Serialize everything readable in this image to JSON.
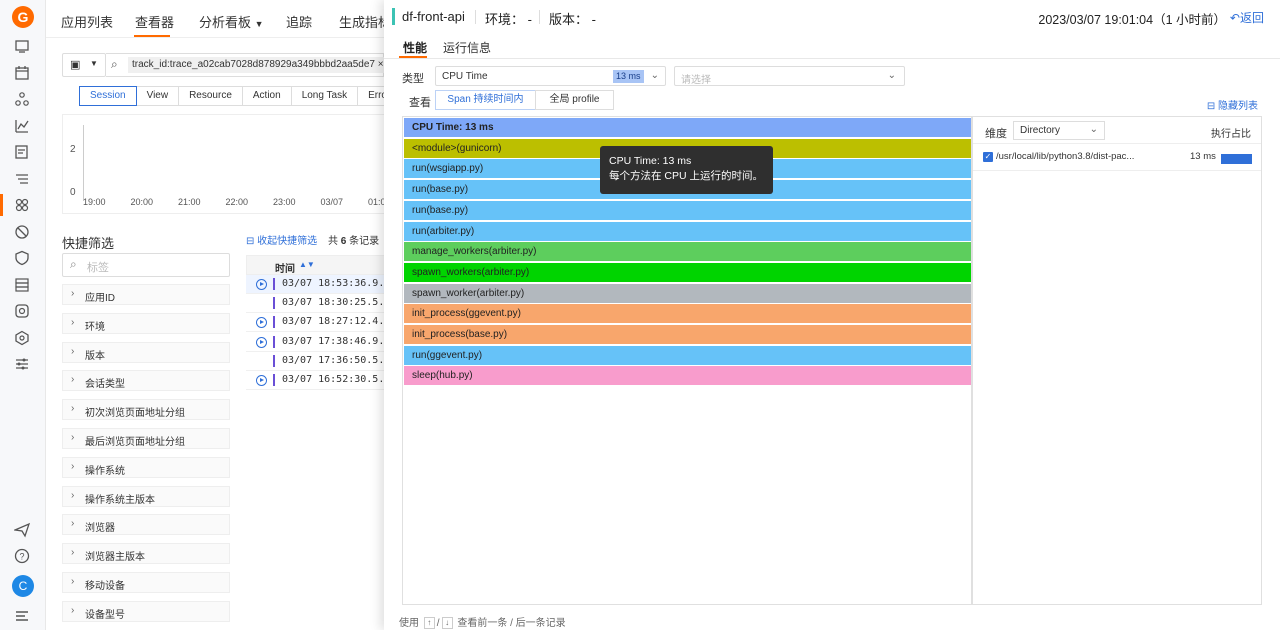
{
  "logo": "G",
  "rail_icons": [
    "dashboard-icon",
    "calendar-icon",
    "cluster-icon",
    "metrics-icon",
    "logs-icon",
    "list-icon",
    "apps-icon",
    "security-icon",
    "shield-icon",
    "database-icon",
    "disk-icon",
    "settings-icon",
    "sliders-icon"
  ],
  "rail_bottom": {
    "avatar": "C",
    "icons": [
      "send-icon",
      "help-icon",
      "menu-icon"
    ]
  },
  "topnav": [
    "应用列表",
    "查看器",
    "分析看板",
    "追踪",
    "生成指标"
  ],
  "search": {
    "chip": "track_id:trace_a02cab7028d878929a349bbbd2aa5de7"
  },
  "view_tabs": [
    "Session",
    "View",
    "Resource",
    "Action",
    "Long Task",
    "Error"
  ],
  "mini_chart": {
    "y_ticks": [
      "2",
      "0"
    ],
    "x_ticks": [
      "19:00",
      "20:00",
      "21:00",
      "22:00",
      "23:00",
      "03/07",
      "01:0"
    ]
  },
  "quick_filter": {
    "title": "快捷筛选",
    "placeholder": "标签",
    "facets": [
      "应用ID",
      "环境",
      "版本",
      "会话类型",
      "初次浏览页面地址分组",
      "最后浏览页面地址分组",
      "操作系统",
      "操作系统主版本",
      "浏览器",
      "浏览器主版本",
      "移动设备",
      "设备型号"
    ]
  },
  "list": {
    "collapse": "收起快捷筛选",
    "count_prefix": "共",
    "count": "6",
    "count_suffix": "条记录",
    "time_header": "时间",
    "rows": [
      {
        "time": "03/07 18:53:36.9...",
        "play": true
      },
      {
        "time": "03/07 18:30:25.5...",
        "play": false
      },
      {
        "time": "03/07 18:27:12.4...",
        "play": true
      },
      {
        "time": "03/07 17:38:46.9...",
        "play": true
      },
      {
        "time": "03/07 17:36:50.5...",
        "play": false
      },
      {
        "time": "03/07 16:52:30.5...",
        "play": true
      }
    ]
  },
  "drawer": {
    "service": "df-front-api",
    "env_label": "环境：",
    "env_value": "-",
    "version_label": "版本：",
    "version_value": "-",
    "time": "2023/03/07 19:01:04（1 小时前）",
    "back": "返回",
    "tabs": [
      "性能",
      "运行信息"
    ],
    "type_label": "类型",
    "type_value": "CPU Time",
    "type_badge": "13 ms",
    "filter_placeholder": "请选择",
    "view_label": "查看",
    "view_options": [
      "Span 持续时间内",
      "全局 profile"
    ],
    "hide_list": "隐藏列表",
    "footer": {
      "prefix": "使用",
      "up": "↑",
      "slash": "/",
      "down": "↓",
      "suffix": "查看前一条 / 后一条记录"
    }
  },
  "flame_frames": [
    {
      "label": "CPU Time: 13 ms",
      "color": "#7ea8f8",
      "bold": true
    },
    {
      "label": "<module>(gunicorn)",
      "color": "#bcbf00"
    },
    {
      "label": "run(wsgiapp.py)",
      "color": "#66c2f8"
    },
    {
      "label": "run(base.py)",
      "color": "#66c2f8"
    },
    {
      "label": "run(base.py)",
      "color": "#66c2f8"
    },
    {
      "label": "run(arbiter.py)",
      "color": "#66c2f8"
    },
    {
      "label": "manage_workers(arbiter.py)",
      "color": "#5dce5d"
    },
    {
      "label": "spawn_workers(arbiter.py)",
      "color": "#00d400"
    },
    {
      "label": "spawn_worker(arbiter.py)",
      "color": "#b2b8be"
    },
    {
      "label": "init_process(ggevent.py)",
      "color": "#f8a66c"
    },
    {
      "label": "init_process(base.py)",
      "color": "#f8a66c"
    },
    {
      "label": "run(ggevent.py)",
      "color": "#66c2f8"
    },
    {
      "label": "sleep(hub.py)",
      "color": "#f89ccc"
    }
  ],
  "tooltip": {
    "line1": "CPU Time: 13 ms",
    "line2": "每个方法在 CPU 上运行的时间。"
  },
  "dimension": {
    "label": "维度",
    "value": "Directory",
    "ratio_label": "执行占比",
    "rows": [
      {
        "path": "/usr/local/lib/python3.8/dist-pac...",
        "value": "13 ms",
        "ratio": 1.0
      }
    ]
  }
}
